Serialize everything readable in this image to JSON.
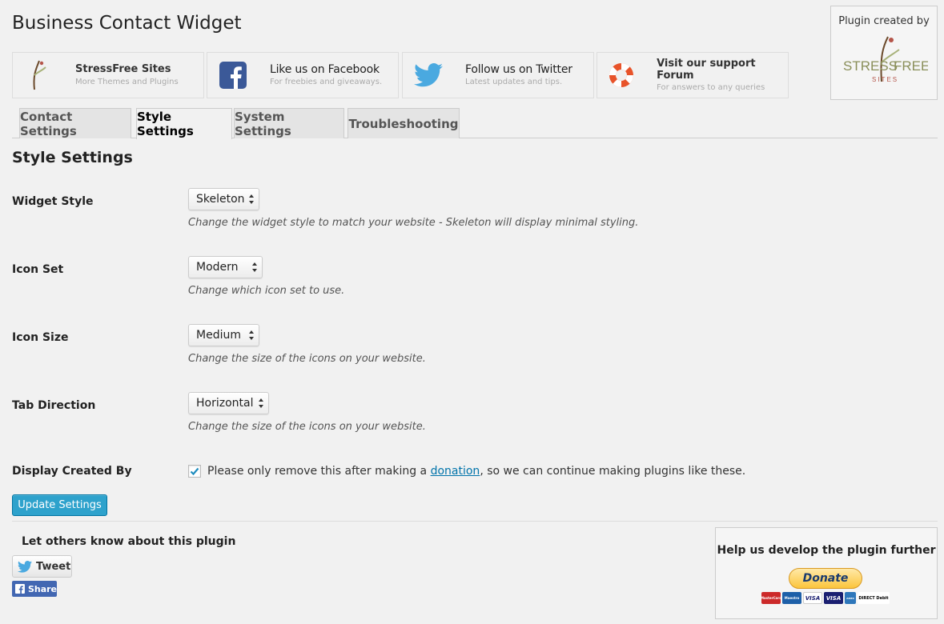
{
  "page": {
    "title": "Business Contact Widget"
  },
  "promos": [
    {
      "title": "StressFree Sites",
      "subtitle": "More Themes and Plugins",
      "icon": "stressfree-figure-icon"
    },
    {
      "title": "Like us on Facebook",
      "subtitle": "For freebies and giveaways.",
      "icon": "facebook-icon"
    },
    {
      "title": "Follow us on Twitter",
      "subtitle": "Latest updates and tips.",
      "icon": "twitter-bird-icon"
    },
    {
      "title": "Visit our support Forum",
      "subtitle": "For answers to any queries",
      "icon": "lifebuoy-icon"
    }
  ],
  "credit": {
    "caption": "Plugin created by",
    "logo_left": "STRESS",
    "logo_right": "FREE",
    "logo_sub": "SITES"
  },
  "tabs": [
    {
      "label": "Contact Settings",
      "active": false
    },
    {
      "label": "Style Settings",
      "active": true
    },
    {
      "label": "System Settings",
      "active": false
    },
    {
      "label": "Troubleshooting",
      "active": false
    }
  ],
  "section": {
    "heading": "Style Settings"
  },
  "settings": [
    {
      "label": "Widget Style",
      "value": "Skeleton",
      "description": "Change the widget style to match your website - Skeleton will display minimal styling."
    },
    {
      "label": "Icon Set",
      "value": "Modern",
      "description": "Change which icon set to use."
    },
    {
      "label": "Icon Size",
      "value": "Medium",
      "description": "Change the size of the icons on your website."
    },
    {
      "label": "Tab Direction",
      "value": "Horizontal",
      "description": "Change the size of the icons on your website."
    }
  ],
  "display_created_by": {
    "label": "Display Created By",
    "checked": true,
    "text_before": "Please only remove this after making a ",
    "link": "donation",
    "text_after": ", so we can continue making plugins like these."
  },
  "update_button": "Update Settings",
  "share": {
    "heading": "Let others know about this plugin",
    "tweet": "Tweet",
    "fb": "Share"
  },
  "donate": {
    "caption": "Help us develop the plugin further",
    "button": "Donate",
    "cards": [
      "MasterCard",
      "Maestro",
      "VISA",
      "VISA",
      "AMEX",
      "DIRECT Debit"
    ]
  },
  "colors": {
    "accent": "#2ea2cc",
    "link": "#0073aa",
    "facebook": "#3b5998",
    "twitter": "#4aa9e0"
  }
}
